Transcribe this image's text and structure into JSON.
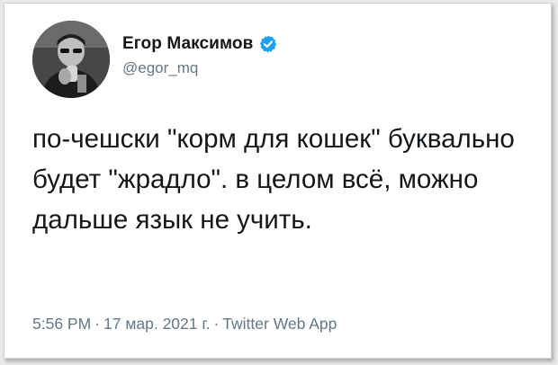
{
  "tweet": {
    "author_name": "Егор Максимов",
    "author_handle": "@egor_mq",
    "verified": true,
    "text": "по-чешски \"корм для кошек\" буквально будет \"жрадло\". в целом всё, можно дальше язык не учить.",
    "time": "5:56 PM",
    "date": "17 мар. 2021 г.",
    "source": "Twitter Web App",
    "separator": "·"
  },
  "colors": {
    "text_primary": "#14171a",
    "text_secondary": "#657786",
    "verified_blue": "#1da1f2"
  },
  "icons": {
    "verified": "verified-badge-icon",
    "avatar": "avatar-photo"
  }
}
